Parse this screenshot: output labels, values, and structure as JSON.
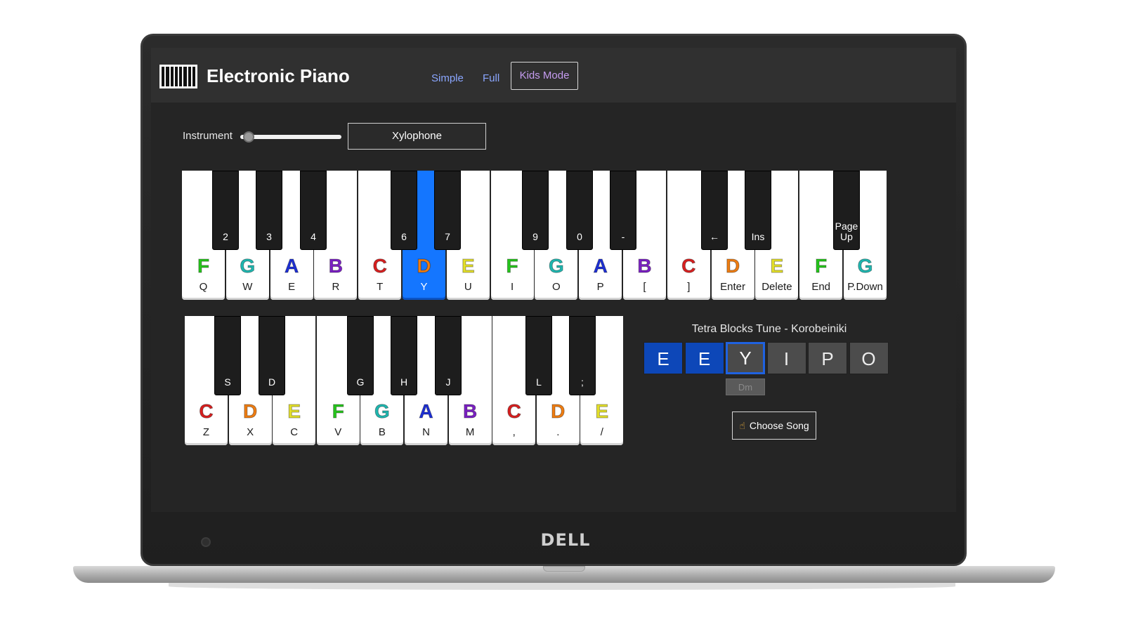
{
  "app": {
    "title": "Electronic Piano",
    "brand": "DELL"
  },
  "modes": {
    "simple": "Simple",
    "full": "Full",
    "kids": "Kids Mode",
    "active": "Kids Mode"
  },
  "instrument": {
    "label": "Instrument",
    "selected": "Xylophone",
    "slider_level": 0.05
  },
  "colors": {
    "C": "#d81f1f",
    "D": "#ef7d12",
    "E": "#e4e02a",
    "F": "#26c61c",
    "G": "#1fb7b0",
    "A": "#1d2fd6",
    "B": "#7b1fc4",
    "active_key": "#1476ff"
  },
  "keyboard_upper": {
    "white_keys": [
      {
        "note": "F",
        "key": "Q"
      },
      {
        "note": "G",
        "key": "W"
      },
      {
        "note": "A",
        "key": "E"
      },
      {
        "note": "B",
        "key": "R"
      },
      {
        "note": "C",
        "key": "T"
      },
      {
        "note": "D",
        "key": "Y",
        "active": true
      },
      {
        "note": "E",
        "key": "U"
      },
      {
        "note": "F",
        "key": "I"
      },
      {
        "note": "G",
        "key": "O"
      },
      {
        "note": "A",
        "key": "P"
      },
      {
        "note": "B",
        "key": "["
      },
      {
        "note": "C",
        "key": "]"
      },
      {
        "note": "D",
        "key": "Enter"
      },
      {
        "note": "E",
        "key": "Delete"
      },
      {
        "note": "F",
        "key": "End"
      },
      {
        "note": "G",
        "key": "P.Down"
      }
    ],
    "black_keys": [
      {
        "key": "2"
      },
      {
        "key": "3"
      },
      {
        "key": "4"
      },
      {
        "key": "6"
      },
      {
        "key": "7"
      },
      {
        "key": "9"
      },
      {
        "key": "0"
      },
      {
        "key": "-"
      },
      {
        "key": "←"
      },
      {
        "key": "Ins"
      },
      {
        "key": "Page Up"
      }
    ]
  },
  "keyboard_lower": {
    "white_keys": [
      {
        "note": "C",
        "key": "Z"
      },
      {
        "note": "D",
        "key": "X"
      },
      {
        "note": "E",
        "key": "C"
      },
      {
        "note": "F",
        "key": "V"
      },
      {
        "note": "G",
        "key": "B"
      },
      {
        "note": "A",
        "key": "N"
      },
      {
        "note": "B",
        "key": "M"
      },
      {
        "note": "C",
        "key": ","
      },
      {
        "note": "D",
        "key": "."
      },
      {
        "note": "E",
        "key": "/"
      }
    ],
    "black_keys": [
      {
        "key": "S"
      },
      {
        "key": "D"
      },
      {
        "key": "G"
      },
      {
        "key": "H"
      },
      {
        "key": "J"
      },
      {
        "key": "L"
      },
      {
        "key": ";"
      }
    ]
  },
  "song": {
    "title": "Tetra Blocks Tune - Korobeiniki",
    "sequence": [
      "E",
      "E",
      "Y",
      "I",
      "P",
      "O"
    ],
    "played_count": 2,
    "current_index": 2,
    "chord": "Dm",
    "choose_label": "Choose Song",
    "choose_icon": "pointing-hand-icon"
  }
}
